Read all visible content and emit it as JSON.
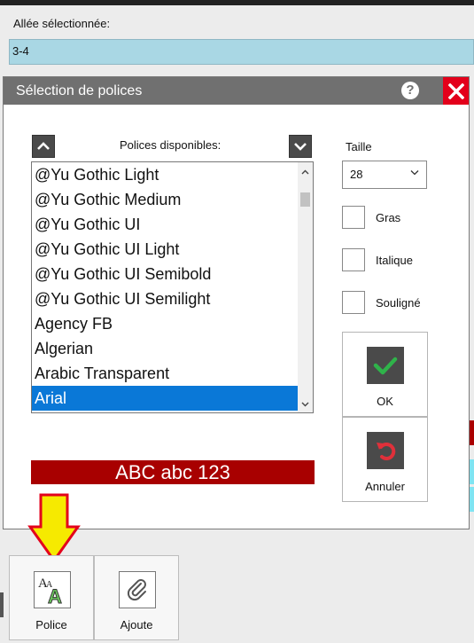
{
  "background": {
    "aisle_label": "Allée sélectionnée:",
    "aisle_value": "3-4"
  },
  "dialog": {
    "title": "Sélection de polices",
    "fonts_label": "Polices disponibles:",
    "fonts": [
      "@Yu Gothic Light",
      "@Yu Gothic Medium",
      "@Yu Gothic UI",
      "@Yu Gothic UI Light",
      "@Yu Gothic UI Semibold",
      "@Yu Gothic UI Semilight",
      "Agency FB",
      "Algerian",
      "Arabic Transparent",
      "Arial"
    ],
    "selected_font": "Arial",
    "preview_text": "ABC abc 123",
    "size_label": "Taille",
    "size_value": "28",
    "bold_label": "Gras",
    "italic_label": "Italique",
    "underline_label": "Souligné",
    "ok_label": "OK",
    "cancel_label": "Annuler"
  },
  "toolbar": {
    "font_label": "Police",
    "attach_label": "Ajoute"
  },
  "colors": {
    "selection": "#0a78d7",
    "preview_bg": "#a80000",
    "close_red": "#e3001b",
    "check_green": "#2fb34a",
    "undo_red": "#e0303a",
    "arrow_yellow": "#f6ea00"
  }
}
